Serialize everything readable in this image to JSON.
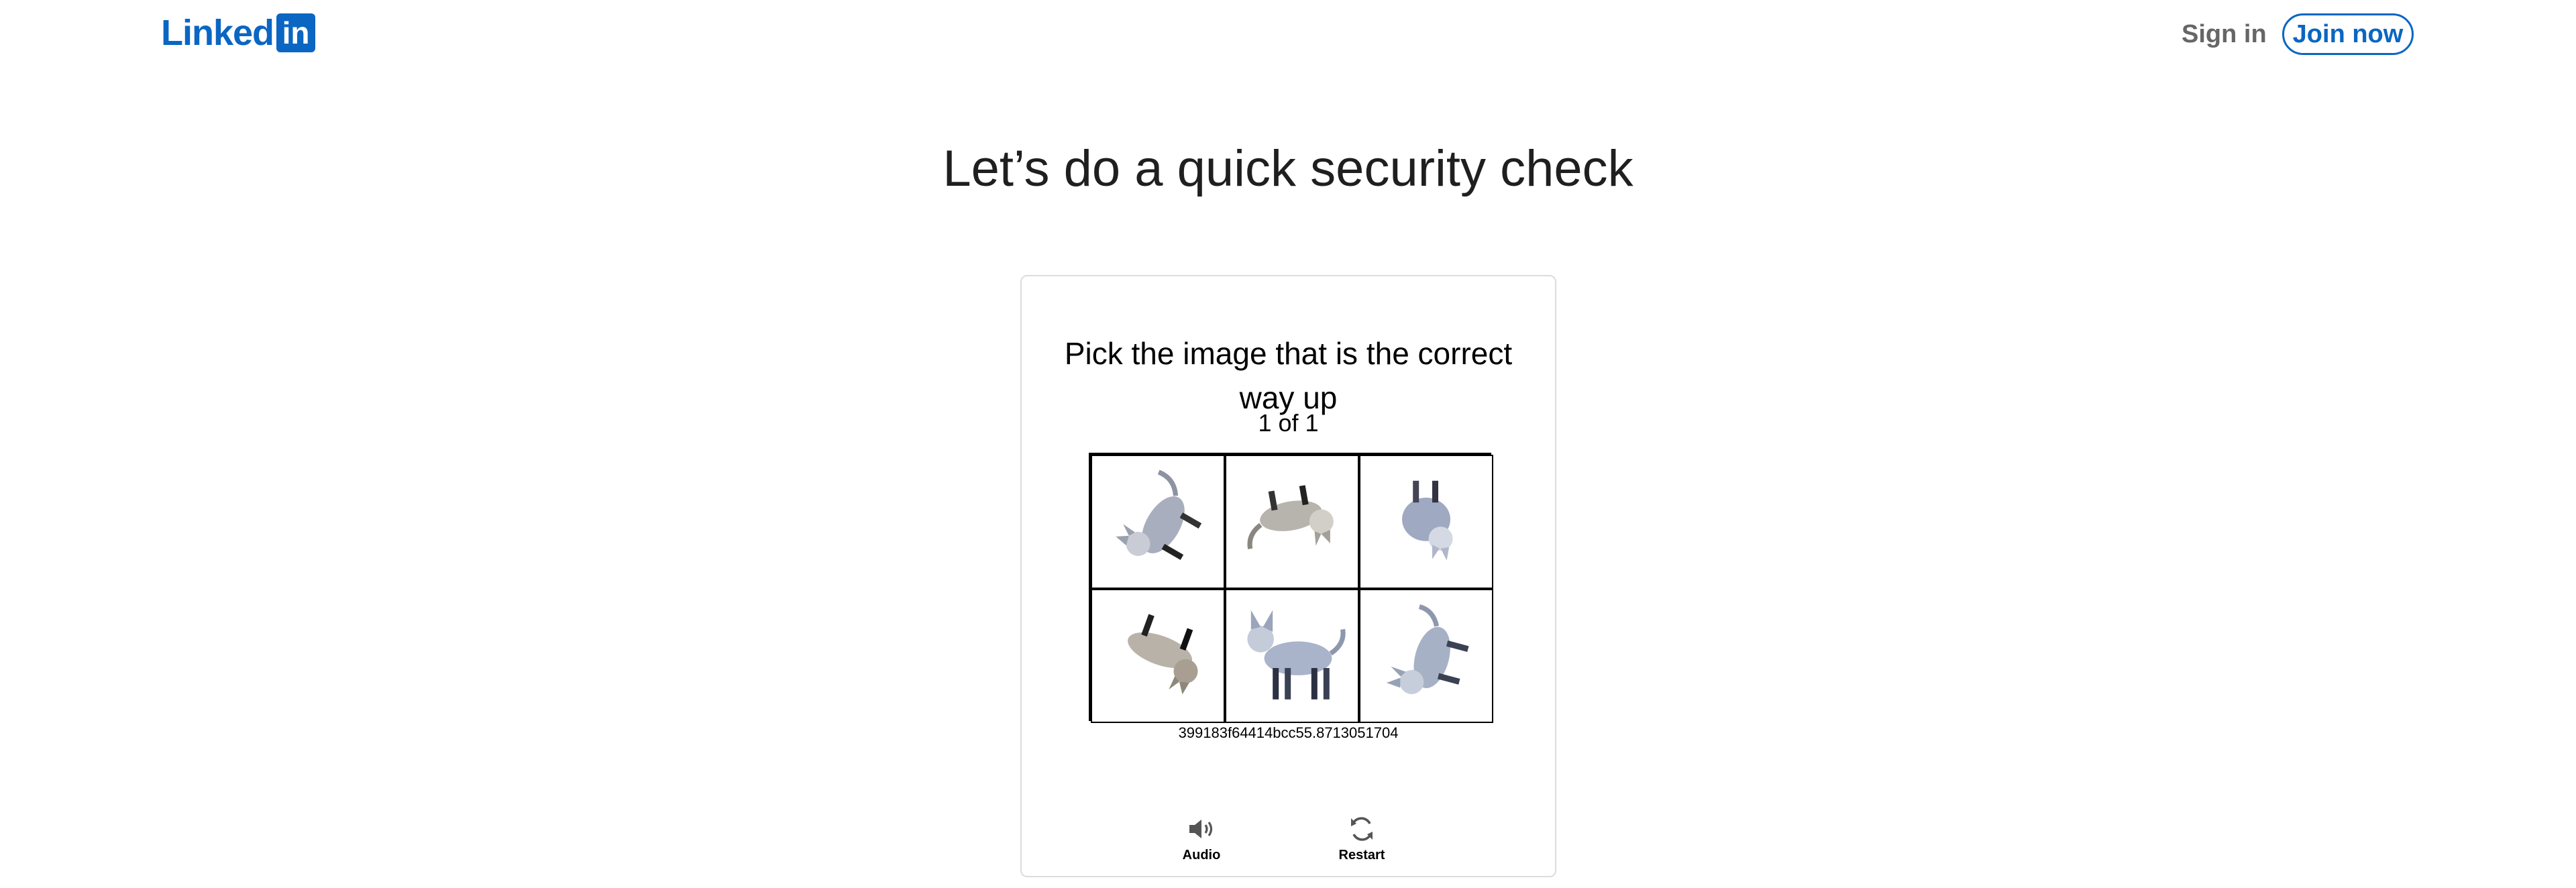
{
  "header": {
    "logo_text": "Linked",
    "logo_box": "in",
    "sign_in": "Sign in",
    "join_now": "Join now"
  },
  "headline": "Let’s do a quick security check",
  "challenge": {
    "prompt": "Pick the image that is the correct way up",
    "counter": "1 of 1",
    "session_id": "399183f64414bcc55.8713051704",
    "tiles": [
      {
        "icon": "cat-rotated-icon"
      },
      {
        "icon": "cat-rotated-icon"
      },
      {
        "icon": "cat-rotated-icon"
      },
      {
        "icon": "cat-rotated-icon"
      },
      {
        "icon": "cat-upright-icon"
      },
      {
        "icon": "cat-rotated-icon"
      }
    ],
    "audio_label": "Audio",
    "restart_label": "Restart"
  },
  "colors": {
    "brand": "#0a66c2",
    "text": "#1f1f1f"
  }
}
